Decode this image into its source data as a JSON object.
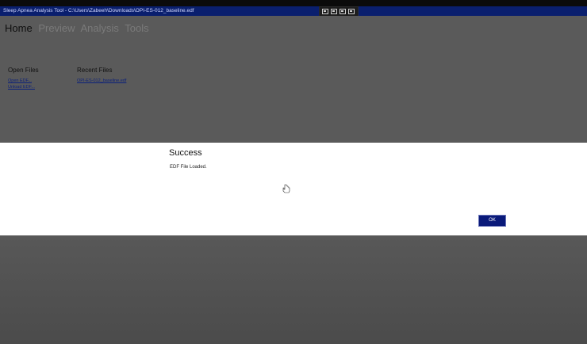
{
  "window": {
    "title": "Sleep Apnea Analysis Tool - C:\\Users\\Zabeeh\\Downloads\\OPI-ES-012_baseline.edf"
  },
  "nav": {
    "tabs": [
      {
        "label": "Home",
        "active": true
      },
      {
        "label": "Preview",
        "active": false
      },
      {
        "label": "Analysis",
        "active": false
      },
      {
        "label": "Tools",
        "active": false
      }
    ]
  },
  "home": {
    "open_files": {
      "title": "Open Files",
      "links": [
        "Open EDF...",
        "Unload EDF..."
      ]
    },
    "recent_files": {
      "title": "Recent Files",
      "links": [
        "OPI-ES-012_baseline.edf"
      ]
    }
  },
  "dialog": {
    "title": "Success",
    "message": "EDF File Loaded.",
    "ok_label": "OK"
  },
  "colors": {
    "titlebar": "#0a1f6e",
    "button": "#0a1a7a",
    "overlay": "#5a5a5a"
  }
}
